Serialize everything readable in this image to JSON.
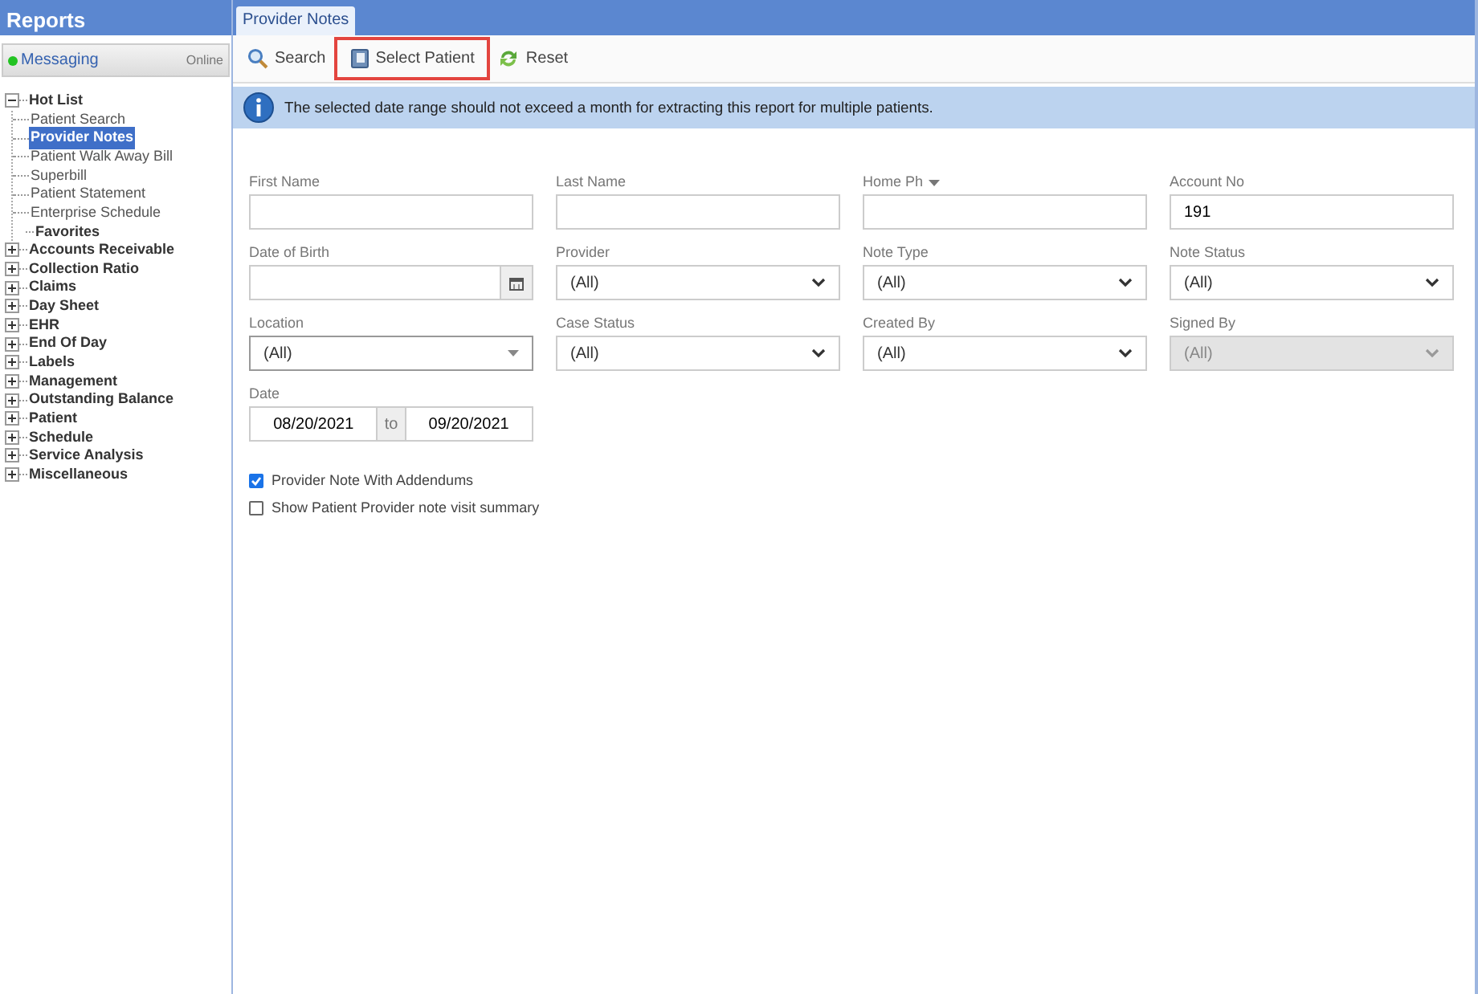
{
  "sidebar": {
    "title": "Reports",
    "messaging": {
      "label": "Messaging",
      "status": "Online",
      "online": true
    },
    "tree": [
      {
        "label": "Hot List",
        "expanded": true,
        "selected": false,
        "children": [
          {
            "label": "Patient Search",
            "selected": false
          },
          {
            "label": "Provider Notes",
            "selected": true
          },
          {
            "label": "Patient Walk Away Bill",
            "selected": false
          },
          {
            "label": "Superbill",
            "selected": false
          },
          {
            "label": "Patient Statement",
            "selected": false
          },
          {
            "label": "Enterprise Schedule",
            "selected": false
          }
        ]
      },
      {
        "label": "Favorites",
        "selected": false
      },
      {
        "label": "Accounts Receivable",
        "expanded": false,
        "selected": false
      },
      {
        "label": "Collection Ratio",
        "expanded": false,
        "selected": false
      },
      {
        "label": "Claims",
        "expanded": false,
        "selected": false
      },
      {
        "label": "Day Sheet",
        "expanded": false,
        "selected": false
      },
      {
        "label": "EHR",
        "expanded": false,
        "selected": false
      },
      {
        "label": "End Of Day",
        "expanded": false,
        "selected": false
      },
      {
        "label": "Labels",
        "expanded": false,
        "selected": false
      },
      {
        "label": "Management",
        "expanded": false,
        "selected": false
      },
      {
        "label": "Outstanding Balance",
        "expanded": false,
        "selected": false
      },
      {
        "label": "Patient",
        "expanded": false,
        "selected": false
      },
      {
        "label": "Schedule",
        "expanded": false,
        "selected": false
      },
      {
        "label": "Service Analysis",
        "expanded": false,
        "selected": false
      },
      {
        "label": "Miscellaneous",
        "expanded": false,
        "selected": false
      }
    ]
  },
  "tabs": [
    {
      "label": "Provider Notes",
      "selected": true
    }
  ],
  "toolbar": [
    {
      "kind": "search",
      "label": "Search",
      "highlighted": false
    },
    {
      "kind": "patient",
      "label": "Select Patient",
      "highlighted": true
    },
    {
      "kind": "reset",
      "label": "Reset",
      "highlighted": false
    }
  ],
  "info": "The selected date range should not exceed a month for extracting this report for multiple patients.",
  "fields": [
    {
      "kind": "text",
      "label": "First Name",
      "disabled": false
    },
    {
      "kind": "text",
      "label": "Last Name",
      "disabled": false
    },
    {
      "kind": "text",
      "label": "Home Ph",
      "label_menu": true,
      "disabled": false
    },
    {
      "kind": "text",
      "label": "Account No",
      "value": "191",
      "disabled": false
    },
    {
      "kind": "date",
      "label": "Date of Birth",
      "disabled": false
    },
    {
      "kind": "select",
      "label": "Provider",
      "value": "(All)",
      "disabled": false
    },
    {
      "kind": "select",
      "label": "Note Type",
      "value": "(All)",
      "disabled": false
    },
    {
      "kind": "select",
      "label": "Note Status",
      "value": "(All)",
      "disabled": false
    },
    {
      "kind": "combo",
      "label": "Location",
      "value": "(All)",
      "disabled": false
    },
    {
      "kind": "select",
      "label": "Case Status",
      "value": "(All)",
      "disabled": false
    },
    {
      "kind": "select",
      "label": "Created By",
      "value": "(All)",
      "disabled": false
    },
    {
      "kind": "select",
      "label": "Signed By",
      "value": "(All)",
      "disabled": true
    },
    {
      "kind": "daterange",
      "label": "Date",
      "from": "08/20/2021",
      "separator": "to",
      "to": "09/20/2021"
    }
  ],
  "options": [
    {
      "label": "Provider Note With Addendums",
      "checked": true
    },
    {
      "label": "Show Patient Provider note visit summary",
      "checked": false
    }
  ]
}
